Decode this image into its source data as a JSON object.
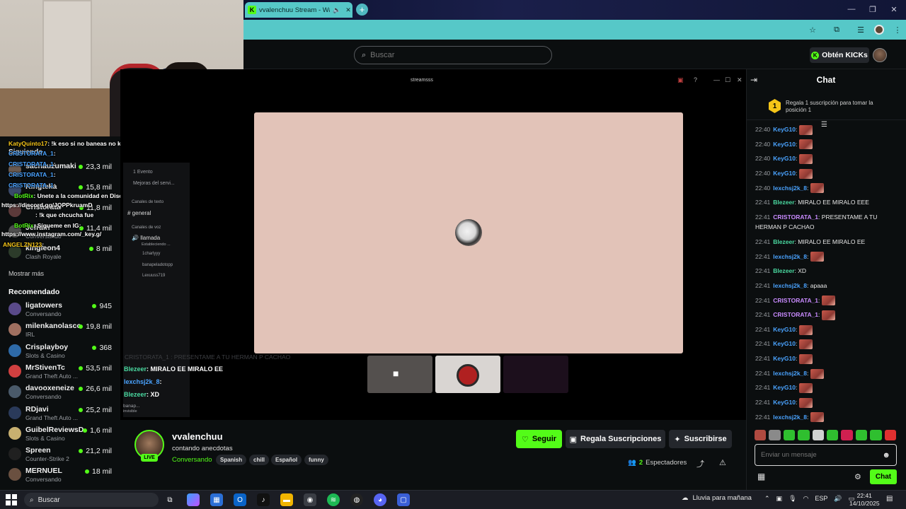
{
  "browser": {
    "tab_title": "vvalenchuu Stream - Watch",
    "new_tab": "+",
    "win_min": "—",
    "win_max": "❐",
    "win_close": "✕"
  },
  "header": {
    "search_placeholder": "Buscar",
    "get_kicks_label": "Obtén KICKs"
  },
  "sidebar": {
    "following_label": "Siguiendo",
    "show_more": "Mostrar más",
    "recommended_label": "Recomendado",
    "following": [
      {
        "name": "sachauzumaki",
        "category": "",
        "viewers": "23,3 mil",
        "color": "#6b5a4f"
      },
      {
        "name": "Kingteka",
        "category": "",
        "viewers": "15,8 mil",
        "color": "#3a4a6b"
      },
      {
        "name": "Cristorata",
        "category": "",
        "viewers": "11,8 mil",
        "color": "#5c3a3a"
      },
      {
        "name": "Jefrain",
        "category": "Conversando",
        "viewers": "11,4 mil",
        "color": "#4f4f4f"
      },
      {
        "name": "kingleon4",
        "category": "Clash Royale",
        "viewers": "8 mil",
        "color": "#2c3b2a"
      }
    ],
    "recommended": [
      {
        "name": "ligatowers",
        "category": "Conversando",
        "viewers": "945",
        "color": "#5a4a8a"
      },
      {
        "name": "milenkanolasco",
        "category": "IRL",
        "viewers": "19,8 mil",
        "color": "#a07060"
      },
      {
        "name": "Crisplayboy",
        "category": "Slots & Casino",
        "viewers": "368",
        "color": "#2e6aa8"
      },
      {
        "name": "MrStivenTc",
        "category": "Grand Theft Auto ...",
        "viewers": "53,5 mil",
        "color": "#d04040"
      },
      {
        "name": "davooxeneize",
        "category": "Conversando",
        "viewers": "26,6 mil",
        "color": "#4a5a6a"
      },
      {
        "name": "RDjavi",
        "category": "Grand Theft Auto ...",
        "viewers": "25,2 mil",
        "color": "#2a3a5a"
      },
      {
        "name": "GuibelReviewsD...",
        "category": "Slots & Casino",
        "viewers": "1,6 mil",
        "color": "#c8b070"
      },
      {
        "name": "Spreen",
        "category": "Counter-Strike 2",
        "viewers": "21,2 mil",
        "color": "#202020"
      },
      {
        "name": "MERNUEL",
        "category": "Conversando",
        "viewers": "18 mil",
        "color": "#6a5040"
      }
    ]
  },
  "overlay_chat": [
    {
      "user": "KatyQuinto17",
      "text": ": !k eso si no baneas no kick de mrd",
      "color": "#f5c518"
    },
    {
      "user": "CRISTORATA_1",
      "text": ":",
      "color": "#4aa3ff"
    },
    {
      "user": "CRISTORATA_1",
      "text": ":",
      "color": "#4aa3ff"
    },
    {
      "user": "CRISTORATA_1",
      "text": ":",
      "color": "#4aa3ff"
    },
    {
      "user": "CRISTORATA_1",
      "text": ":",
      "color": "#4aa3ff"
    },
    {
      "user": "BotRix",
      "text": ": Unete a la comunidad en Discord:",
      "color": "#53fc18"
    },
    {
      "user": "",
      "text": "https://discord.gg/JQPPkruamD",
      "color": "#fff"
    },
    {
      "user": "",
      "text": ": !k que chcucha fue",
      "color": "#fff"
    },
    {
      "user": "BotRix",
      "text": ": Sígueme en IG:",
      "color": "#53fc18"
    },
    {
      "user": "",
      "text": "https://www.instagram.com/_key.g/",
      "color": "#fff"
    },
    {
      "user": "ANGELZN123",
      "text": ":",
      "color": "#f5c518"
    }
  ],
  "player": {
    "window_title": "streamsss",
    "discord": {
      "events": "1 Evento",
      "improvements": "Mejoras del servi...",
      "text_channels": "Canales de texto",
      "general": "general",
      "voice_channels": "Canales de voz",
      "voice_call": "llamada",
      "voice_status": "Estableciendo ...",
      "members": [
        "1charlyyy",
        "banapeladotopp",
        "Lexuuss719"
      ],
      "user": "banap...",
      "user_status": "invisible"
    },
    "ghost_chat": "CRISTORATA_1 : PRESENTAME A TU HERMAN P CACHAO",
    "stream_chat": [
      {
        "user": "Blezeer",
        "text": ": MIRALO EE MIRALO EE",
        "color": "#4ad9a0"
      },
      {
        "user": "lexchsj2k_8",
        "text": ":",
        "color": "#4aa3ff"
      },
      {
        "user": "Blezeer",
        "text": ": XD",
        "color": "#4ad9a0"
      }
    ]
  },
  "channel": {
    "name": "vvalenchuu",
    "live": "LIVE",
    "title": "contando anecdotas",
    "category": "Conversando",
    "tags": [
      "Spanish",
      "chill",
      "Español",
      "funny"
    ],
    "follow_label": "Seguir",
    "gift_label": "Regala Suscripciones",
    "subscribe_label": "Suscribirse",
    "viewer_count": "2",
    "viewer_label": "Espectadores"
  },
  "chat": {
    "title": "Chat",
    "gift_badge": "1",
    "gift_text": "Regala 1 suscripción para tomar la posición 1",
    "input_placeholder": "Enviar un mensaje",
    "send_label": "Chat",
    "messages": [
      {
        "time": "22:40",
        "user": "KeyG10",
        "text": "",
        "color": "#4aa3ff",
        "emote": true
      },
      {
        "time": "22:40",
        "user": "KeyG10",
        "text": "",
        "color": "#4aa3ff",
        "emote": true
      },
      {
        "time": "22:40",
        "user": "KeyG10",
        "text": "",
        "color": "#4aa3ff",
        "emote": true
      },
      {
        "time": "22:40",
        "user": "KeyG10",
        "text": "",
        "color": "#4aa3ff",
        "emote": true
      },
      {
        "time": "22:40",
        "user": "lexchsj2k_8",
        "text": "",
        "color": "#4aa3ff",
        "emote": true
      },
      {
        "time": "22:41",
        "user": "Blezeer",
        "text": "MIRALO EE MIRALO EEE",
        "color": "#4ad9a0",
        "emote": false
      },
      {
        "time": "22:41",
        "user": "CRISTORATA_1",
        "text": "PRESENTAME A TU HERMAN P CACHAO",
        "color": "#c98bff",
        "emote": false
      },
      {
        "time": "22:41",
        "user": "Blezeer",
        "text": "MIRALO EE MIRALO EE",
        "color": "#4ad9a0",
        "emote": false
      },
      {
        "time": "22:41",
        "user": "lexchsj2k_8",
        "text": "",
        "color": "#4aa3ff",
        "emote": true
      },
      {
        "time": "22:41",
        "user": "Blezeer",
        "text": "XD",
        "color": "#4ad9a0",
        "emote": false
      },
      {
        "time": "22:41",
        "user": "lexchsj2k_8",
        "text": "apaaa",
        "color": "#4aa3ff",
        "emote": false
      },
      {
        "time": "22:41",
        "user": "CRISTORATA_1",
        "text": "",
        "color": "#c98bff",
        "emote": true
      },
      {
        "time": "22:41",
        "user": "CRISTORATA_1",
        "text": "",
        "color": "#c98bff",
        "emote": true
      },
      {
        "time": "22:41",
        "user": "KeyG10",
        "text": "",
        "color": "#4aa3ff",
        "emote": true
      },
      {
        "time": "22:41",
        "user": "KeyG10",
        "text": "",
        "color": "#4aa3ff",
        "emote": true
      },
      {
        "time": "22:41",
        "user": "KeyG10",
        "text": "",
        "color": "#4aa3ff",
        "emote": true
      },
      {
        "time": "22:41",
        "user": "lexchsj2k_8",
        "text": "",
        "color": "#4aa3ff",
        "emote": true
      },
      {
        "time": "22:41",
        "user": "KeyG10",
        "text": "",
        "color": "#4aa3ff",
        "emote": true
      },
      {
        "time": "22:41",
        "user": "KeyG10",
        "text": "",
        "color": "#4aa3ff",
        "emote": true
      },
      {
        "time": "22:41",
        "user": "lexchsj2k_8",
        "text": "",
        "color": "#4aa3ff",
        "emote": true
      }
    ],
    "emote_colors": [
      "#b04a40",
      "#8a8a8a",
      "#2fbf2f",
      "#2fbf2f",
      "#d0d0d0",
      "#2fbf2f",
      "#d02050",
      "#2fbf2f",
      "#2fbf2f",
      "#e03030"
    ]
  },
  "taskbar": {
    "search_label": "Buscar",
    "weather": "Lluvia para mañana",
    "lang": "ESP",
    "time": "22:41",
    "date": "14/10/2025"
  },
  "colors": {
    "accent": "#53fc18",
    "background": "#0b0e0f",
    "browser_teal": "#56c8c8"
  }
}
